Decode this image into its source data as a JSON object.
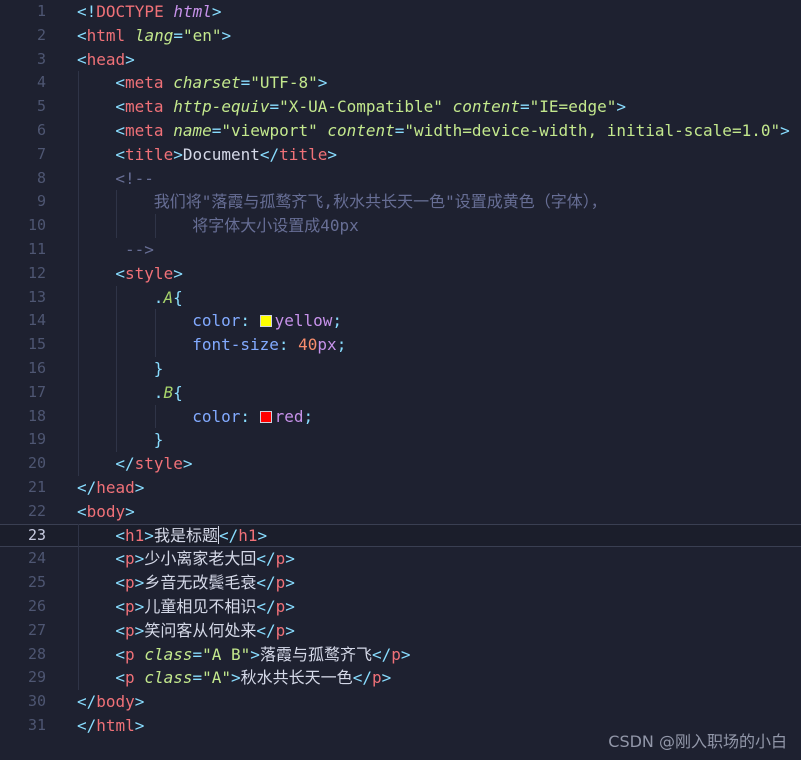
{
  "editor": {
    "current_line": 23,
    "colors": {
      "background": "#1e2130",
      "tag": "#f07178",
      "attribute": "#c3e88d",
      "comment": "#676e95",
      "swatch_yellow": "#ffff00",
      "swatch_red": "#ff0000"
    },
    "lines": [
      {
        "n": "1",
        "indent": 0,
        "tokens": [
          [
            "p",
            "<!"
          ],
          [
            "t",
            "DOCTYPE"
          ],
          [
            "tx",
            " "
          ],
          [
            "doc-kw",
            "html"
          ],
          [
            "p",
            ">"
          ]
        ]
      },
      {
        "n": "2",
        "indent": 0,
        "tokens": [
          [
            "p",
            "<"
          ],
          [
            "t",
            "html"
          ],
          [
            "tx",
            " "
          ],
          [
            "a",
            "lang"
          ],
          [
            "p",
            "="
          ],
          [
            "s",
            "\"en\""
          ],
          [
            "p",
            ">"
          ]
        ]
      },
      {
        "n": "3",
        "indent": 0,
        "tokens": [
          [
            "p",
            "<"
          ],
          [
            "t",
            "head"
          ],
          [
            "p",
            ">"
          ]
        ]
      },
      {
        "n": "4",
        "indent": 1,
        "tokens": [
          [
            "p",
            "<"
          ],
          [
            "t",
            "meta"
          ],
          [
            "tx",
            " "
          ],
          [
            "a",
            "charset"
          ],
          [
            "p",
            "="
          ],
          [
            "s",
            "\"UTF-8\""
          ],
          [
            "p",
            ">"
          ]
        ]
      },
      {
        "n": "5",
        "indent": 1,
        "tokens": [
          [
            "p",
            "<"
          ],
          [
            "t",
            "meta"
          ],
          [
            "tx",
            " "
          ],
          [
            "a",
            "http-equiv"
          ],
          [
            "p",
            "="
          ],
          [
            "s",
            "\"X-UA-Compatible\""
          ],
          [
            "tx",
            " "
          ],
          [
            "a",
            "content"
          ],
          [
            "p",
            "="
          ],
          [
            "s",
            "\"IE=edge\""
          ],
          [
            "p",
            ">"
          ]
        ]
      },
      {
        "n": "6",
        "indent": 1,
        "tokens": [
          [
            "p",
            "<"
          ],
          [
            "t",
            "meta"
          ],
          [
            "tx",
            " "
          ],
          [
            "a",
            "name"
          ],
          [
            "p",
            "="
          ],
          [
            "s",
            "\"viewport\""
          ],
          [
            "tx",
            " "
          ],
          [
            "a",
            "content"
          ],
          [
            "p",
            "="
          ],
          [
            "s",
            "\"width=device-width, initial-scale=1.0\""
          ],
          [
            "p",
            ">"
          ]
        ]
      },
      {
        "n": "7",
        "indent": 1,
        "tokens": [
          [
            "p",
            "<"
          ],
          [
            "t",
            "title"
          ],
          [
            "p",
            ">"
          ],
          [
            "tx",
            "Document"
          ],
          [
            "p",
            "</"
          ],
          [
            "t",
            "title"
          ],
          [
            "p",
            ">"
          ]
        ]
      },
      {
        "n": "8",
        "indent": 1,
        "tokens": [
          [
            "c",
            "<!--"
          ]
        ]
      },
      {
        "n": "9",
        "indent": 2,
        "tokens": [
          [
            "c",
            "我们将\"落霞与孤鹜齐飞,秋水共长天一色\"设置成黄色（字体），"
          ]
        ]
      },
      {
        "n": "10",
        "indent": 3,
        "tokens": [
          [
            "c",
            "将字体大小设置成40px"
          ]
        ]
      },
      {
        "n": "11",
        "indent": 1,
        "tokens": [
          [
            "c",
            " -->"
          ]
        ]
      },
      {
        "n": "12",
        "indent": 1,
        "tokens": [
          [
            "p",
            "<"
          ],
          [
            "t",
            "style"
          ],
          [
            "p",
            ">"
          ]
        ]
      },
      {
        "n": "13",
        "indent": 2,
        "tokens": [
          [
            "p",
            "."
          ],
          [
            "sel",
            "A"
          ],
          [
            "p",
            "{"
          ]
        ]
      },
      {
        "n": "14",
        "indent": 3,
        "tokens": [
          [
            "prop",
            "color"
          ],
          [
            "p",
            ": "
          ],
          [
            "swatch",
            "#ffff00"
          ],
          [
            "val",
            "yellow"
          ],
          [
            "p",
            ";"
          ]
        ]
      },
      {
        "n": "15",
        "indent": 3,
        "tokens": [
          [
            "prop",
            "font-size"
          ],
          [
            "p",
            ": "
          ],
          [
            "num",
            "40"
          ],
          [
            "unit",
            "px"
          ],
          [
            "p",
            ";"
          ]
        ]
      },
      {
        "n": "16",
        "indent": 2,
        "tokens": [
          [
            "p",
            "}"
          ]
        ]
      },
      {
        "n": "17",
        "indent": 2,
        "tokens": [
          [
            "p",
            "."
          ],
          [
            "sel",
            "B"
          ],
          [
            "p",
            "{"
          ]
        ]
      },
      {
        "n": "18",
        "indent": 3,
        "tokens": [
          [
            "prop",
            "color"
          ],
          [
            "p",
            ": "
          ],
          [
            "swatch",
            "#ff0000"
          ],
          [
            "val",
            "red"
          ],
          [
            "p",
            ";"
          ]
        ]
      },
      {
        "n": "19",
        "indent": 2,
        "tokens": [
          [
            "p",
            "}"
          ]
        ]
      },
      {
        "n": "20",
        "indent": 1,
        "tokens": [
          [
            "p",
            "</"
          ],
          [
            "t",
            "style"
          ],
          [
            "p",
            ">"
          ]
        ]
      },
      {
        "n": "21",
        "indent": 0,
        "tokens": [
          [
            "p",
            "</"
          ],
          [
            "t",
            "head"
          ],
          [
            "p",
            ">"
          ]
        ]
      },
      {
        "n": "22",
        "indent": 0,
        "tokens": [
          [
            "p",
            "<"
          ],
          [
            "t",
            "body"
          ],
          [
            "p",
            ">"
          ]
        ]
      },
      {
        "n": "23",
        "indent": 1,
        "tokens": [
          [
            "p",
            "<"
          ],
          [
            "t",
            "h1"
          ],
          [
            "p",
            ">"
          ],
          [
            "tx",
            "我是标题"
          ],
          [
            "caret",
            ""
          ],
          [
            "p",
            "</"
          ],
          [
            "t",
            "h1"
          ],
          [
            "p",
            ">"
          ]
        ]
      },
      {
        "n": "24",
        "indent": 1,
        "tokens": [
          [
            "p",
            "<"
          ],
          [
            "t",
            "p"
          ],
          [
            "p",
            ">"
          ],
          [
            "tx",
            "少小离家老大回"
          ],
          [
            "p",
            "</"
          ],
          [
            "t",
            "p"
          ],
          [
            "p",
            ">"
          ]
        ]
      },
      {
        "n": "25",
        "indent": 1,
        "tokens": [
          [
            "p",
            "<"
          ],
          [
            "t",
            "p"
          ],
          [
            "p",
            ">"
          ],
          [
            "tx",
            "乡音无改鬓毛衰"
          ],
          [
            "p",
            "</"
          ],
          [
            "t",
            "p"
          ],
          [
            "p",
            ">"
          ]
        ]
      },
      {
        "n": "26",
        "indent": 1,
        "tokens": [
          [
            "p",
            "<"
          ],
          [
            "t",
            "p"
          ],
          [
            "p",
            ">"
          ],
          [
            "tx",
            "儿童相见不相识"
          ],
          [
            "p",
            "</"
          ],
          [
            "t",
            "p"
          ],
          [
            "p",
            ">"
          ]
        ]
      },
      {
        "n": "27",
        "indent": 1,
        "tokens": [
          [
            "p",
            "<"
          ],
          [
            "t",
            "p"
          ],
          [
            "p",
            ">"
          ],
          [
            "tx",
            "笑问客从何处来"
          ],
          [
            "p",
            "</"
          ],
          [
            "t",
            "p"
          ],
          [
            "p",
            ">"
          ]
        ]
      },
      {
        "n": "28",
        "indent": 1,
        "tokens": [
          [
            "p",
            "<"
          ],
          [
            "t",
            "p"
          ],
          [
            "tx",
            " "
          ],
          [
            "a",
            "class"
          ],
          [
            "p",
            "="
          ],
          [
            "s",
            "\"A B\""
          ],
          [
            "p",
            ">"
          ],
          [
            "tx",
            "落霞与孤鹜齐飞"
          ],
          [
            "p",
            "</"
          ],
          [
            "t",
            "p"
          ],
          [
            "p",
            ">"
          ]
        ]
      },
      {
        "n": "29",
        "indent": 1,
        "tokens": [
          [
            "p",
            "<"
          ],
          [
            "t",
            "p"
          ],
          [
            "tx",
            " "
          ],
          [
            "a",
            "class"
          ],
          [
            "p",
            "="
          ],
          [
            "s",
            "\"A\""
          ],
          [
            "p",
            ">"
          ],
          [
            "tx",
            "秋水共长天一色"
          ],
          [
            "p",
            "</"
          ],
          [
            "t",
            "p"
          ],
          [
            "p",
            ">"
          ]
        ]
      },
      {
        "n": "30",
        "indent": 0,
        "tokens": [
          [
            "p",
            "</"
          ],
          [
            "t",
            "body"
          ],
          [
            "p",
            ">"
          ]
        ]
      },
      {
        "n": "31",
        "indent": 0,
        "tokens": [
          [
            "p",
            "</"
          ],
          [
            "t",
            "html"
          ],
          [
            "p",
            ">"
          ]
        ]
      }
    ]
  },
  "watermark": "CSDN @刚入职场的小白"
}
